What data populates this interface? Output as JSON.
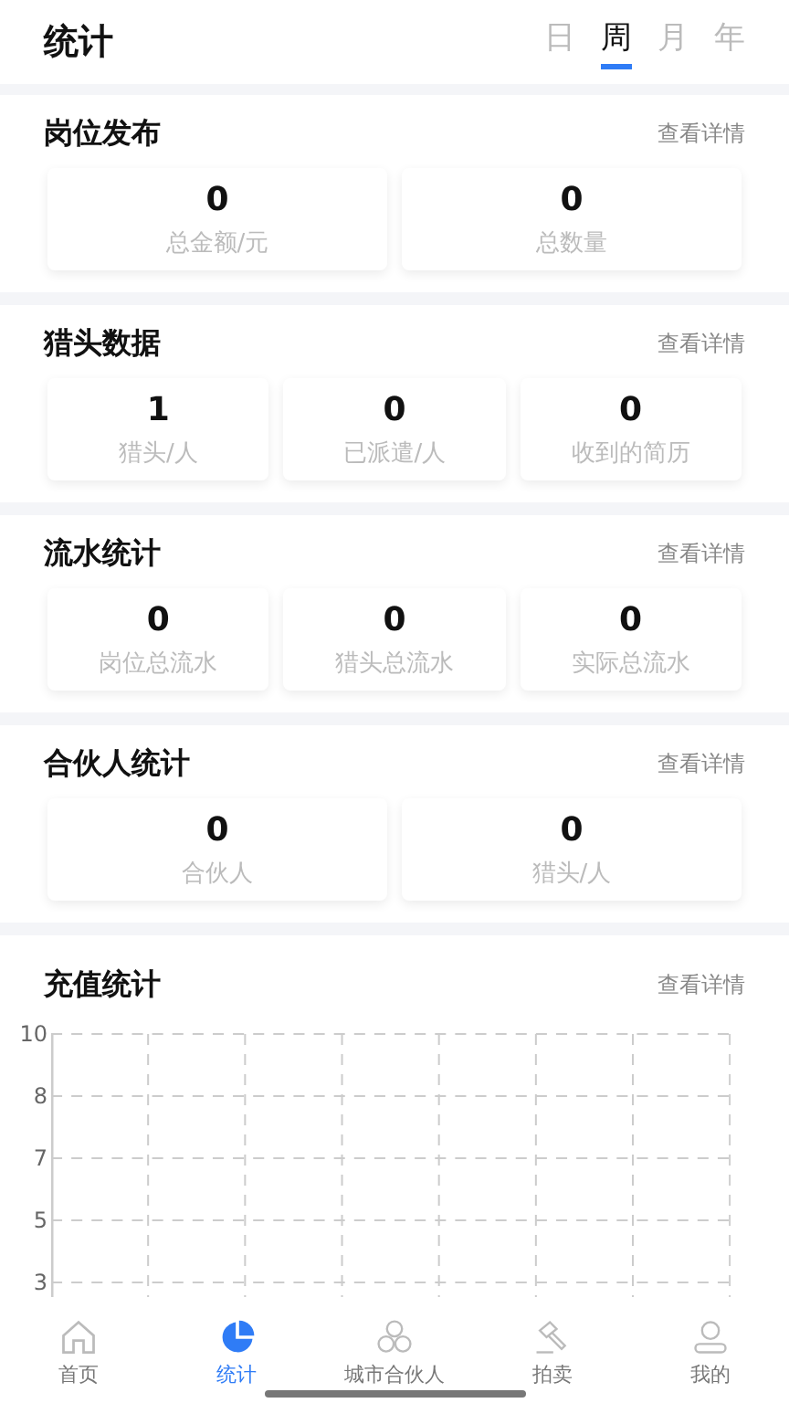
{
  "header": {
    "title": "统计",
    "periods": [
      {
        "label": "日",
        "selected": false
      },
      {
        "label": "周",
        "selected": true
      },
      {
        "label": "月",
        "selected": false
      },
      {
        "label": "年",
        "selected": false
      }
    ]
  },
  "sections": [
    {
      "title": "岗位发布",
      "link": "查看详情",
      "stats": [
        {
          "value": "0",
          "label": "总金额/元"
        },
        {
          "value": "0",
          "label": "总数量"
        }
      ]
    },
    {
      "title": "猎头数据",
      "link": "查看详情",
      "stats": [
        {
          "value": "1",
          "label": "猎头/人"
        },
        {
          "value": "0",
          "label": "已派遣/人"
        },
        {
          "value": "0",
          "label": "收到的简历"
        }
      ]
    },
    {
      "title": "流水统计",
      "link": "查看详情",
      "stats": [
        {
          "value": "0",
          "label": "岗位总流水"
        },
        {
          "value": "0",
          "label": "猎头总流水"
        },
        {
          "value": "0",
          "label": "实际总流水"
        }
      ]
    },
    {
      "title": "合伙人统计",
      "link": "查看详情",
      "stats": [
        {
          "value": "0",
          "label": "合伙人"
        },
        {
          "value": "0",
          "label": "猎头/人"
        }
      ]
    }
  ],
  "recharge": {
    "title": "充值统计",
    "link": "查看详情",
    "y_labels": [
      "10",
      "8",
      "7",
      "5",
      "3"
    ]
  },
  "tab_bar": [
    {
      "label": "首页",
      "kind": "home",
      "selected": false
    },
    {
      "label": "统计",
      "kind": "stats",
      "selected": true
    },
    {
      "label": "城市合伙人",
      "kind": "partners",
      "selected": false
    },
    {
      "label": "拍卖",
      "kind": "auction",
      "selected": false
    },
    {
      "label": "我的",
      "kind": "profile",
      "selected": false
    }
  ]
}
